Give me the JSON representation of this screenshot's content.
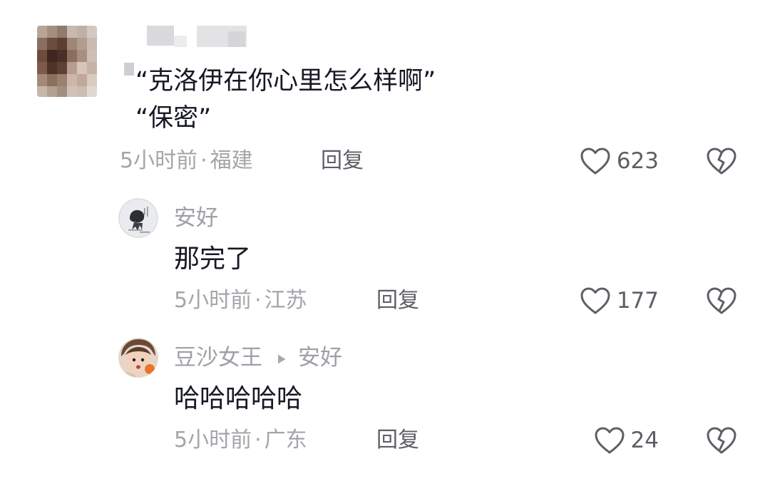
{
  "comment": {
    "text": "“克洛伊在你心里怎么样啊”\n“保密”",
    "time": "5小时前",
    "location": "福建",
    "reply_label": "回复",
    "likes": "623",
    "mosaic_colors": [
      "#b9a596",
      "#a48f80",
      "#8f7a6c",
      "#c7b9ae",
      "#bfb1a6",
      "#d4c9c1",
      "#8a6f61",
      "#6b4c3e",
      "#5c3f33",
      "#a08677",
      "#b29c8f",
      "#c9bbb0",
      "#6e4b3c",
      "#3e2720",
      "#4a2f26",
      "#8c6e5f",
      "#a98f80",
      "#cdbfb5",
      "#7d5b4b",
      "#4f3328",
      "#5e4034",
      "#b59e90",
      "#d8c5b8",
      "#c6b3a6",
      "#a4897a",
      "#8c705f",
      "#9b8070",
      "#cdb7a9",
      "#c0a99b",
      "#d9cbc1",
      "#c7b6aa",
      "#b3a090",
      "#a28f80",
      "#d1c2b7",
      "#cbbdb1",
      "#e2d8d0"
    ]
  },
  "replies": [
    {
      "author": "安好",
      "text": "那完了",
      "time": "5小时前",
      "location": "江苏",
      "reply_label": "回复",
      "likes": "177"
    },
    {
      "author": "豆沙女王",
      "reply_to": "安好",
      "text": "哈哈哈哈哈",
      "time": "5小时前",
      "location": "广东",
      "reply_label": "回复",
      "likes": "24"
    }
  ],
  "colors": {
    "text_primary": "#161823",
    "text_secondary": "#a4a5aa",
    "action_text": "#5e5f66"
  },
  "icons": [
    "heart-icon",
    "broken-heart-icon",
    "right-triangle-icon"
  ]
}
